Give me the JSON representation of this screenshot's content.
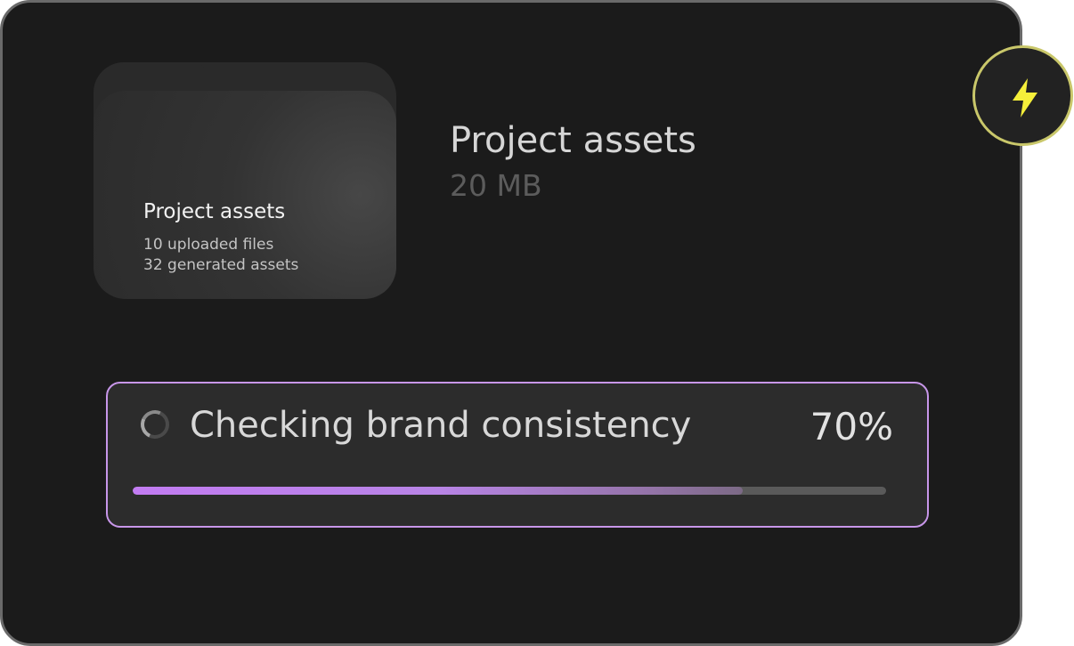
{
  "folder": {
    "title": "Project assets",
    "uploaded": "10 uploaded files",
    "generated": "32 generated assets"
  },
  "asset": {
    "name": "Project assets",
    "size": "20 MB"
  },
  "progress": {
    "label": "Checking brand consistency",
    "value_text": "70%",
    "fill_fraction": 0.81,
    "accent": "#c27cf2"
  },
  "badge": {
    "icon": "lightning-bolt-icon",
    "color": "#f5ef3a"
  },
  "icons": {
    "spinner": "loading-spinner-icon",
    "folder": "folder-icon"
  }
}
